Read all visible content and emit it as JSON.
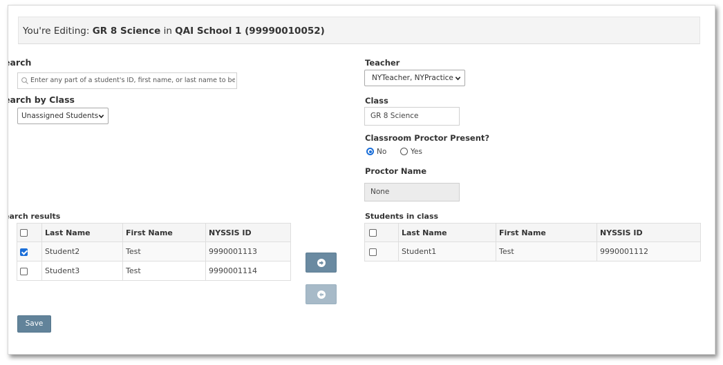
{
  "banner": {
    "prefix": "You're Editing:",
    "class_name": "GR 8 Science",
    "in_word": "in",
    "school": "QAI School 1 (99990010052)"
  },
  "left": {
    "search_label": "earch",
    "search_placeholder": "Enter any part of a student's ID, first name, or last name to begi",
    "class_filter_label": "earch by Class",
    "class_filter_value": "Unassigned Students",
    "results_label": "earch results",
    "columns": [
      "Last Name",
      "First Name",
      "NYSSIS ID"
    ],
    "rows": [
      {
        "checked": true,
        "last": "Student2",
        "first": "Test",
        "id": "9990001113"
      },
      {
        "checked": false,
        "last": "Student3",
        "first": "Test",
        "id": "9990001114"
      }
    ]
  },
  "right": {
    "teacher_label": "Teacher",
    "teacher_value": "NYTeacher, NYPractice",
    "class_label": "Class",
    "class_value": "GR 8 Science",
    "proctor_question": "Classroom Proctor Present?",
    "proctor_options": [
      {
        "label": "No",
        "selected": true
      },
      {
        "label": "Yes",
        "selected": false
      }
    ],
    "proctor_name_label": "Proctor Name",
    "proctor_name_value": "None",
    "students_label": "Students in class",
    "columns": [
      "Last Name",
      "First Name",
      "NYSSIS ID"
    ],
    "rows": [
      {
        "checked": false,
        "last": "Student1",
        "first": "Test",
        "id": "9990001112"
      }
    ]
  },
  "actions": {
    "move_right_icon": "arrow-right-circle-icon",
    "move_left_icon": "arrow-left-circle-icon",
    "save_label": "Save"
  },
  "colors": {
    "primary_button": "#62839a",
    "disabled_button": "#a7bac8",
    "checkbox_accent": "#1a6ed8"
  }
}
